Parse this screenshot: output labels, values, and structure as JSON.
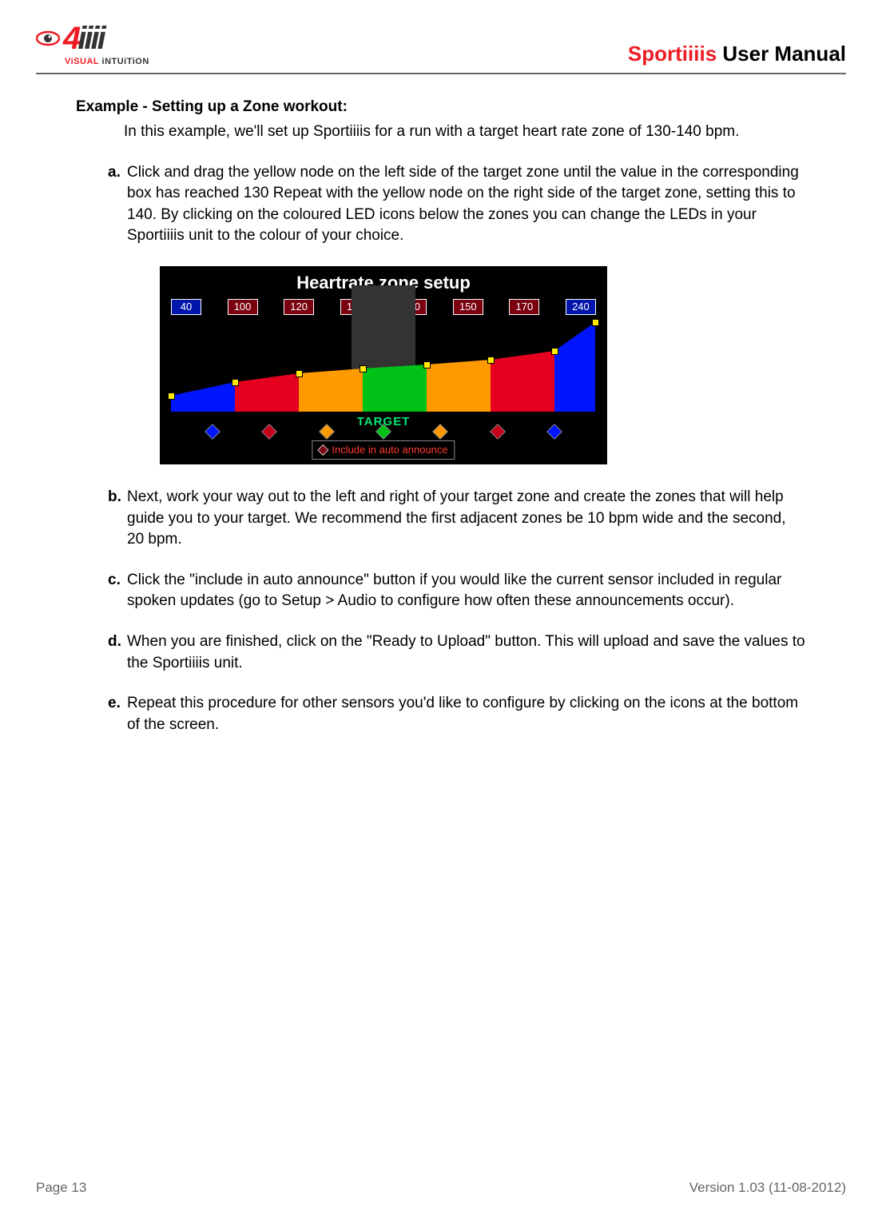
{
  "header": {
    "brand_prefix": "4",
    "brand_suffix": "iiii",
    "tagline_visual": "ViSUAL",
    "tagline_intuition": " iNTUiTiON",
    "doctitle_red": "Sportiiiis",
    "doctitle_rest": " User Manual"
  },
  "heading": "Example - Setting up a Zone workout:",
  "intro": "In this example, we'll set up Sportiiiis for a run with a target heart rate zone of 130-140 bpm.",
  "steps": {
    "a": {
      "label": "a.",
      "text": "Click and drag the yellow node on the left side of the target zone until the value in the corresponding box has reached 130  Repeat with the yellow node on the right side of the target zone, setting this to 140.  By clicking on the coloured LED icons below the zones you can change the LEDs in your Sportiiiis unit to the colour of your choice."
    },
    "b": {
      "label": "b.",
      "text": "Next, work your way out to the left and right of your target zone and create the zones that will help guide you to your target.  We recommend the first adjacent zones be 10 bpm wide and the second, 20 bpm."
    },
    "c": {
      "label": "c.",
      "text": "Click the \"include in auto announce\" button if you would like the current sensor included in regular spoken updates (go to Setup > Audio to configure how often these announcements occur)."
    },
    "d": {
      "label": "d.",
      "text": "When you are finished, click on the \"Ready to Upload\" button.  This will upload and save the values to the Sportiiiis unit."
    },
    "e": {
      "label": "e.",
      "text": "Repeat this procedure for other sensors you'd like to configure by clicking on the icons at the bottom of the screen."
    }
  },
  "chart_data": {
    "type": "area",
    "title": "Heartrate zone setup",
    "zone_values": [
      40,
      100,
      120,
      130,
      140,
      150,
      170,
      240
    ],
    "target_label": "TARGET",
    "auto_announce_label": "Include in auto announce",
    "led_colors": [
      "#0015ff",
      "#c4001a",
      "#ff9900",
      "#00c217",
      "#ff9900",
      "#c4001a",
      "#0015ff"
    ],
    "segment_colors": [
      "#0015ff",
      "#e50020",
      "#ff9900",
      "#00c217",
      "#ff9900",
      "#e50020",
      "#0015ff"
    ]
  },
  "footer": {
    "page": "Page 13",
    "version": "Version 1.03 (11-08-2012)"
  }
}
